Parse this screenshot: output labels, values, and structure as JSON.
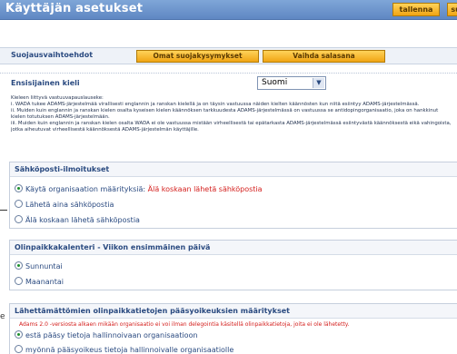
{
  "window": {
    "title": "Käyttäjän asetukset",
    "save_label": "tallenna",
    "close_label": "sulje"
  },
  "tabs": {
    "label": "Suojausvaihtoehdot",
    "own_questions": "Omat suojakysymykset",
    "change_password": "Vaihda salasana"
  },
  "language": {
    "heading": "Ensisijainen kieli",
    "selected": "Suomi",
    "disclaimer": [
      "Kieleen liittyvä vastuuvapauslauseke:",
      "i. WADA tukee ADAMS-järjestelmää virallisesti englannin ja ranskan kielellä ja on täysin vastuussa näiden kielten käännösten kun niitä esiintyy ADAMS-järjestelmässä.",
      "ii. Muiden kuin englannin ja ranskan kielen osalta kyseisen kielen käännöksen tarkkuudesta ADAMS-järjestelmässä on vastuussa se antidopingorganisaatio, joka on hankkinut kielen totutuksen ADAMS-järjestelmään.",
      "iii. Muiden kuin englannin ja ranskan kielen osalta WADA ei ole vastuussa mistään virheellisestä tai epätarkasta ADAMS-järjestelmässä esiintyvästä käännöksestä eikä vahingoista, jotka aiheutuvat virheellisestä käännöksestä ADAMS-järjestelmän käyttäjille."
    ]
  },
  "email": {
    "heading": "Sähköposti-ilmoitukset",
    "options": [
      {
        "prefix": "Käytä organisaation määrityksiä: ",
        "emphasis": "Älä koskaan lähetä sähköpostia",
        "selected": true
      },
      {
        "prefix": "Lähetä aina sähköpostia",
        "emphasis": "",
        "selected": false
      },
      {
        "prefix": "Älä koskaan lähetä sähköpostia",
        "emphasis": "",
        "selected": false
      }
    ]
  },
  "calendar": {
    "heading": "Olinpaikkakalenteri - Viikon ensimmäinen päivä",
    "options": [
      {
        "label": "Sunnuntai",
        "selected": true
      },
      {
        "label": "Maanantai",
        "selected": false
      }
    ]
  },
  "whereabouts": {
    "heading": "Lähettämättömien olinpaikkatietojen pääsyoikeuksien määritykset",
    "notice": "Adams 2.0 -versiosta alkaen mikään organisaatio ei voi ilman delegointia käsitellä olinpaikkatietoja, joita ei ole lähetetty.",
    "options": [
      {
        "label": "estä pääsy tietoja hallinnoivaan organisaatioon",
        "selected": true
      },
      {
        "label": "myönnä pääsyoikeus tietoja hallinnoivalle organisaatiolle",
        "selected": false
      }
    ]
  },
  "margin": {
    "letter": "e"
  }
}
